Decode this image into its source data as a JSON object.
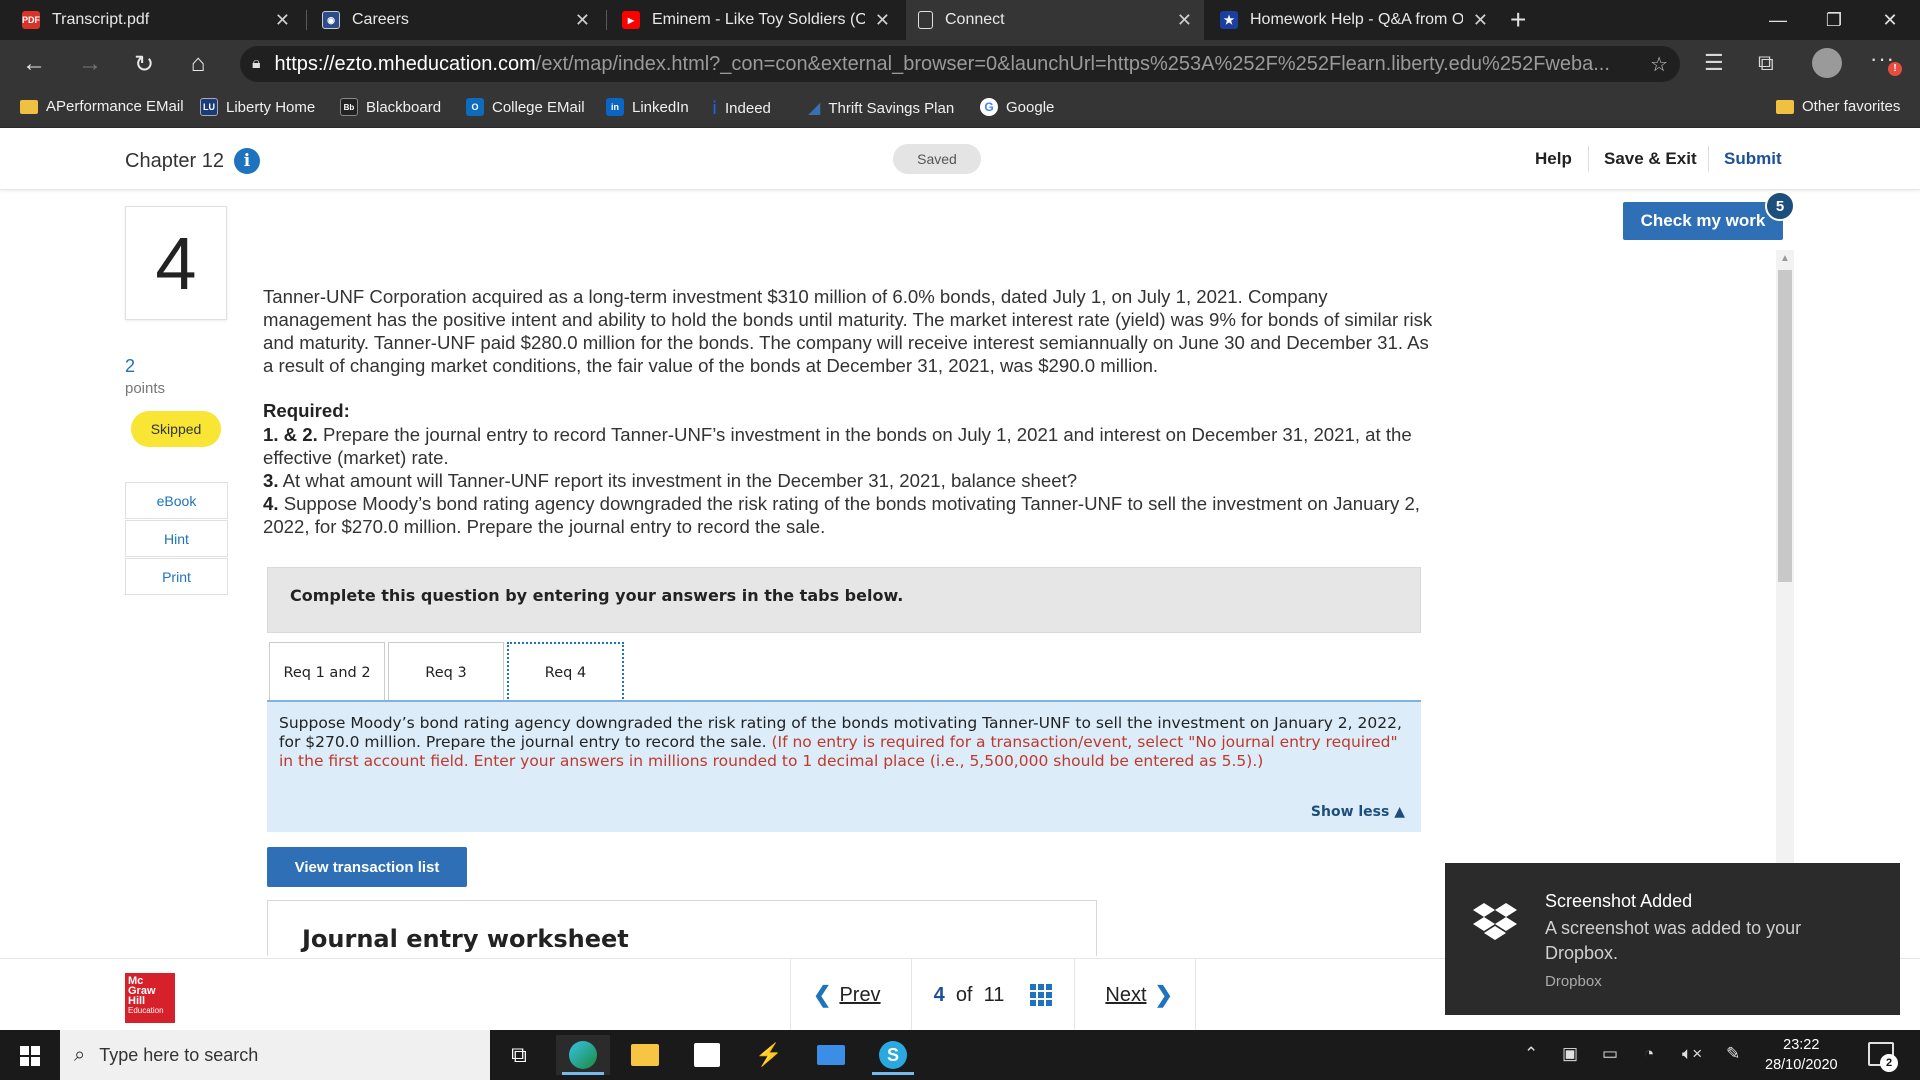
{
  "browser": {
    "tabs": [
      {
        "title": "Transcript.pdf",
        "favicon": "pdf-icon"
      },
      {
        "title": "Careers",
        "favicon": "liberty-seal-icon"
      },
      {
        "title": "Eminem - Like Toy Soldiers (Offic",
        "favicon": "youtube-icon"
      },
      {
        "title": "Connect",
        "favicon": "page-icon"
      },
      {
        "title": "Homework Help - Q&A from On",
        "favicon": "star-icon"
      }
    ],
    "url_host": "https://ezto.mheducation.com",
    "url_path": "/ext/map/index.html?_con=con&external_browser=0&launchUrl=https%253A%252F%252Flearn.liberty.edu%252Fweba...",
    "bookmarks": [
      "APerformance EMail",
      "Liberty Home",
      "Blackboard",
      "College EMail",
      "LinkedIn",
      "Indeed",
      "Thrift Savings Plan",
      "Google"
    ],
    "other_favorites": "Other favorites",
    "profile_alert": "!"
  },
  "header": {
    "chapter": "Chapter 12",
    "saved": "Saved",
    "help": "Help",
    "save_exit": "Save & Exit",
    "submit": "Submit"
  },
  "question": {
    "number": "4",
    "points": "2",
    "points_label": "points",
    "status": "Skipped",
    "side_links": [
      "eBook",
      "Hint",
      "Print"
    ],
    "text": "Tanner-UNF Corporation acquired as a long-term investment $310 million of 6.0% bonds, dated July 1, on July 1, 2021. Company management has the positive intent and ability to hold the bonds until maturity. The market interest rate (yield) was 9% for bonds of similar risk and maturity. Tanner-UNF paid $280.0 million for the bonds. The company will receive interest semiannually on June 30 and December 31. As a result of changing market conditions, the fair value of the bonds at December 31, 2021, was $290.0 million.",
    "required_heading": "Required:",
    "requirements": [
      {
        "num": "1. & 2.",
        "text": "Prepare the journal entry to record Tanner-UNF’s investment in the bonds on July 1, 2021 and interest on December 31, 2021, at the effective (market) rate."
      },
      {
        "num": "3.",
        "text": "At what amount will Tanner-UNF report its investment in the December 31, 2021, balance sheet?"
      },
      {
        "num": "4.",
        "text": "Suppose Moody’s bond rating agency downgraded the risk rating of the bonds motivating Tanner-UNF to sell the investment on January 2, 2022, for $270.0 million. Prepare the journal entry to record the sale."
      }
    ],
    "instruction": "Complete this question by entering your answers in the tabs below.",
    "tabs": [
      "Req 1 and 2",
      "Req 3",
      "Req 4"
    ],
    "active_tab": "Req 4",
    "panel_text": "Suppose Moody’s bond rating agency downgraded the risk rating of the bonds motivating Tanner-UNF to sell the investment on January 2, 2022, for $270.0 million. Prepare the journal entry to record the sale.",
    "panel_note": "(If no entry is required for a transaction/event, select \"No journal entry required\" in the first account field. Enter your answers in millions rounded to 1 decimal place (i.e., 5,500,000 should be entered as 5.5).)",
    "show_less": "Show less",
    "view_transactions": "View transaction list",
    "worksheet_title": "Journal entry worksheet"
  },
  "check": {
    "label": "Check my work",
    "badge": "5"
  },
  "footer": {
    "logo_lines": [
      "Mc",
      "Graw",
      "Hill",
      "Education"
    ],
    "prev": "Prev",
    "current": "4",
    "of": "of",
    "total": "11",
    "next": "Next"
  },
  "toast": {
    "title": "Screenshot Added",
    "body": "A screenshot was added to your Dropbox.",
    "source": "Dropbox"
  },
  "taskbar": {
    "search_placeholder": "Type here to search",
    "time": "23:22",
    "date": "28/10/2020",
    "notifications": "2"
  },
  "colors": {
    "accent": "#1e73be",
    "skipped": "#f8e534",
    "panel": "#dcecf9",
    "note_red": "#c0392b",
    "mh_red": "#d6202a"
  }
}
